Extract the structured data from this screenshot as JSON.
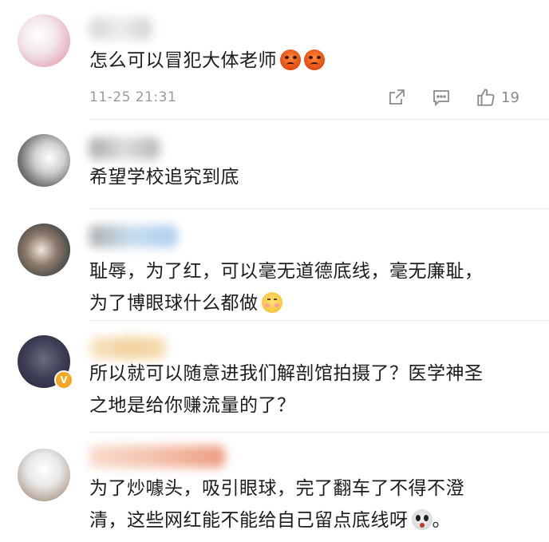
{
  "comments": [
    {
      "text": "怎么可以冒犯大体老师",
      "emojis": [
        "angry-face",
        "angry-face"
      ],
      "timestamp": "11-25 21:31",
      "like_count": "19"
    },
    {
      "text": "希望学校追究到底"
    },
    {
      "line1": "耻辱，为了红，可以毫无道德底线，毫无廉耻，",
      "line2": "为了博眼球什么都做",
      "emojis": [
        "shy-face"
      ]
    },
    {
      "line1": "所以就可以随意进我们解剖馆拍摄了？医学神圣",
      "line2": "之地是给你赚流量的了？",
      "verified": true
    },
    {
      "line1": "为了炒噱头，吸引眼球，完了翻车了不得不澄",
      "line2": "清，这些网红能不能给自己留点底线呀",
      "line2_tail": "。",
      "emojis": [
        "scared-face"
      ]
    }
  ],
  "colors": {
    "text": "#1c1c1c",
    "meta": "#9a9a9a",
    "divider": "#e6e6e6",
    "verified_badge": "#f5a623"
  }
}
